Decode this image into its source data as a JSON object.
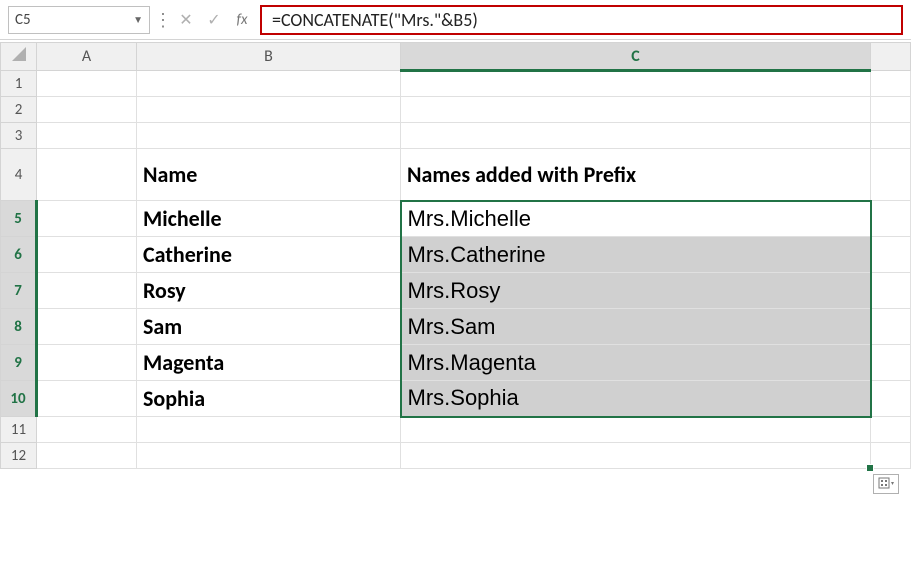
{
  "formula_bar": {
    "name_box": "C5",
    "fx_label": "fx",
    "formula": "=CONCATENATE(\"Mrs.\"&B5)"
  },
  "columns": {
    "A": "A",
    "B": "B",
    "C": "C"
  },
  "row_headers": [
    "1",
    "2",
    "3",
    "4",
    "5",
    "6",
    "7",
    "8",
    "9",
    "10",
    "11",
    "12"
  ],
  "headers": {
    "B4": "Name",
    "C4": "Names added with Prefix"
  },
  "rows": [
    {
      "name": "Michelle",
      "prefixed": "Mrs.Michelle"
    },
    {
      "name": "Catherine",
      "prefixed": "Mrs.Catherine"
    },
    {
      "name": "Rosy",
      "prefixed": "Mrs.Rosy"
    },
    {
      "name": "Sam",
      "prefixed": "Mrs.Sam"
    },
    {
      "name": "Magenta",
      "prefixed": "Mrs.Magenta"
    },
    {
      "name": "Sophia",
      "prefixed": "Mrs.Sophia"
    }
  ],
  "selection": {
    "active": "C5",
    "range": "C5:C10"
  },
  "colors": {
    "accent": "#217346",
    "highlight_border": "#c00000",
    "result_text": "#c00000"
  }
}
